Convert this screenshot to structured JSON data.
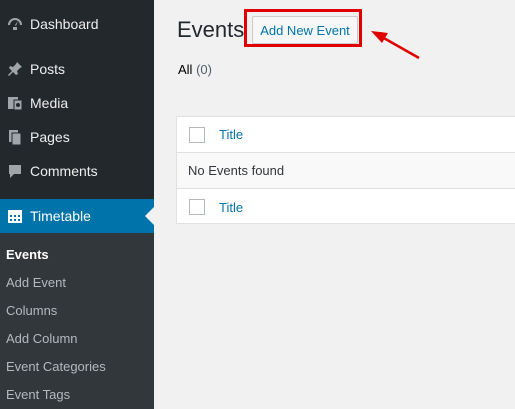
{
  "sidebar": {
    "items": [
      {
        "label": "Dashboard",
        "icon": "dashboard-icon"
      },
      {
        "label": "Posts",
        "icon": "pin-icon"
      },
      {
        "label": "Media",
        "icon": "media-icon"
      },
      {
        "label": "Pages",
        "icon": "pages-icon"
      },
      {
        "label": "Comments",
        "icon": "comment-icon"
      },
      {
        "label": "Timetable",
        "icon": "calendar-icon",
        "current": true
      }
    ],
    "submenu": [
      {
        "label": "Events",
        "current": true
      },
      {
        "label": "Add Event"
      },
      {
        "label": "Columns"
      },
      {
        "label": "Add Column"
      },
      {
        "label": "Event Categories"
      },
      {
        "label": "Event Tags"
      }
    ]
  },
  "main": {
    "title": "Events",
    "add_new_label": "Add New Event",
    "filter": {
      "label": "All",
      "count": "(0)"
    },
    "table": {
      "header_column": "Title",
      "empty_message": "No Events found",
      "footer_column": "Title"
    }
  },
  "colors": {
    "sidebar_bg": "#23282d",
    "submenu_bg": "#32373c",
    "accent": "#0073aa",
    "annotation": "#e00000"
  }
}
